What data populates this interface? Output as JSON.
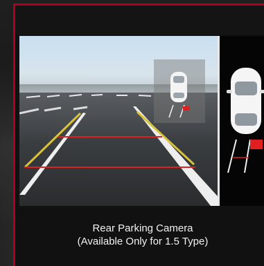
{
  "caption": {
    "title": "Rear Parking Camera",
    "subtitle": "(Available Only for 1.5 Type)"
  },
  "colors": {
    "accent": "#b0001e",
    "guide_yellow": "#d8c23a",
    "guide_red": "#e02020",
    "lane_white": "#f0f0f0"
  },
  "icons": {
    "car_top": "car-top-view-icon",
    "car_inset": "car-inset-icon"
  }
}
